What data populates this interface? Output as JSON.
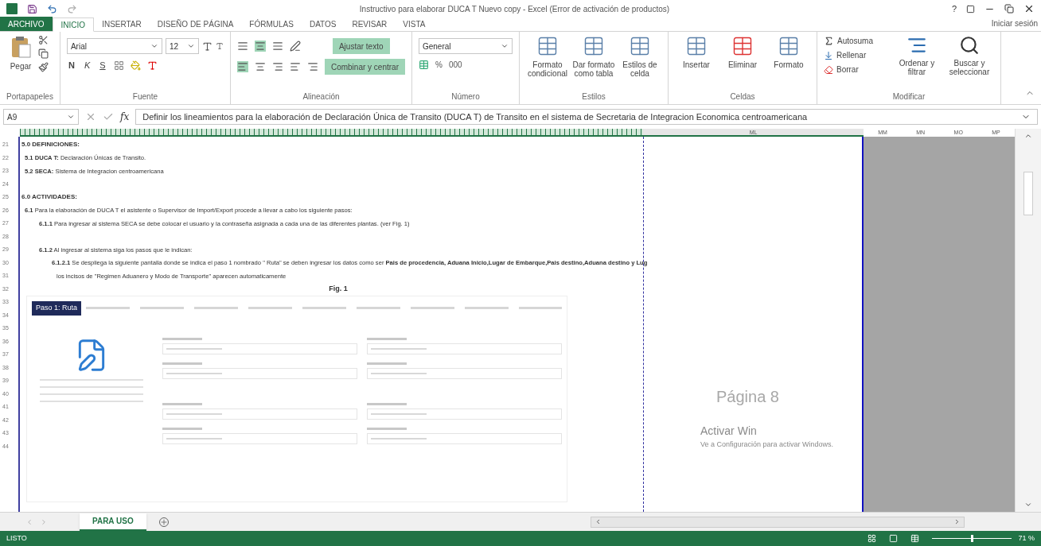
{
  "title_bar": {
    "title": "Instructivo para elaborar DUCA T  Nuevo copy - Excel (Error de activación de productos)",
    "help": "?"
  },
  "ribbon_tabs": [
    {
      "label": "ARCHIVO",
      "kind": "file",
      "selected": false
    },
    {
      "label": "INICIO",
      "kind": "tab",
      "selected": true
    },
    {
      "label": "INSERTAR",
      "kind": "tab",
      "selected": false
    },
    {
      "label": "DISEÑO DE PÁGINA",
      "kind": "tab",
      "selected": false
    },
    {
      "label": "FÓRMULAS",
      "kind": "tab",
      "selected": false
    },
    {
      "label": "DATOS",
      "kind": "tab",
      "selected": false
    },
    {
      "label": "REVISAR",
      "kind": "tab",
      "selected": false
    },
    {
      "label": "VISTA",
      "kind": "tab",
      "selected": false
    }
  ],
  "account": "Iniciar sesión",
  "ribbon_groups": [
    {
      "kind": "clipboard",
      "label": "Portapapeles",
      "paste": "Pegar"
    },
    {
      "kind": "font",
      "label": "Fuente",
      "font_name": "Arial",
      "font_size": "12",
      "styles": [
        "N",
        "K",
        "S"
      ]
    },
    {
      "kind": "alignment",
      "label": "Alineación",
      "toggles": [
        {
          "label": "Ajustar texto",
          "on": true
        },
        {
          "label": "Combinar y centrar",
          "on": true
        }
      ]
    },
    {
      "kind": "number",
      "label": "Número",
      "format": "General",
      "symbols": [
        "%",
        "000"
      ]
    },
    {
      "kind": "styles",
      "label": "Estilos",
      "buttons": [
        {
          "label": "Formato condicional"
        },
        {
          "label": "Dar formato como tabla"
        },
        {
          "label": "Estilos de celda"
        }
      ]
    },
    {
      "kind": "cells",
      "label": "Celdas",
      "buttons": [
        {
          "label": "Insertar"
        },
        {
          "label": "Eliminar"
        },
        {
          "label": "Formato"
        }
      ]
    },
    {
      "kind": "editing",
      "label": "Modificar",
      "small": [
        "Autosuma",
        "Rellenar",
        "Borrar"
      ],
      "large": [
        "Ordenar y filtrar",
        "Buscar y seleccionar"
      ]
    }
  ],
  "formula_bar": {
    "name_box": "A9",
    "function_label": "fx",
    "formula": "Definir los lineamientos para la elaboración de Declaración Única de Transito (DUCA T) de Transito en el sistema de Secretaria de Integracion Economica centroamericana"
  },
  "column_headers": {
    "page": "ML",
    "outside": [
      "MM",
      "MN",
      "MO",
      "MP"
    ]
  },
  "row_numbers": [
    "21",
    "22",
    "23",
    "24",
    "25",
    "26",
    "27",
    "28",
    "29",
    "30",
    "31",
    "32",
    "33",
    "34",
    "35",
    "36",
    "37",
    "38",
    "39",
    "40",
    "41",
    "42",
    "43",
    "44"
  ],
  "rows": [
    {
      "kind": "heading",
      "text": "5.0 DEFINICIONES:"
    },
    {
      "kind": "item",
      "text": "**5.1 DUCA T:** Declaración Únicas de Transito."
    },
    {
      "kind": "item",
      "text": "**5.2 SECA:** Sistema de Integracion centroamericana"
    },
    {
      "kind": "blank"
    },
    {
      "kind": "heading",
      "text": "6.0 ACTIVIDADES:"
    },
    {
      "kind": "item",
      "text": "**6.1** Para la elaboración de DUCA T el asistente o Supervisor de Import/Export  procede a llevar a cabo los siguiente pasos:"
    },
    {
      "kind": "subitem",
      "text": "**6.1.1** Para ingresar al sistema SECA se debe colocar el usuario y la contraseña  asignada a cada una de las diferentes plantas. (ver Fig. 1)"
    },
    {
      "kind": "blank"
    },
    {
      "kind": "subitem",
      "text": "**6.1.2** Al ingresar al sistema siga los pasos que le indican:"
    },
    {
      "kind": "subsubitem",
      "text": "**6.1.2.1**  Se despliega la siguiente pantalla donde se indica el paso 1 nombrado \" Ruta\" se deben ingresar los datos como ser **Pais de procedencia, Aduana Inicio,Lugar de Embarque,Pais destino,Aduana destino y Lug**"
    },
    {
      "kind": "continuation",
      "text": "los incisos de \"Regimen Aduanero y Modo de Transporte\" aparecen automaticamente"
    },
    {
      "kind": "caption",
      "text": "Fig. 1"
    }
  ],
  "figure": {
    "active_tab": "Paso 1: Ruta"
  },
  "page_label": "Página 8",
  "activation": [
    "Activar Win",
    "Ve a Configuración para activar Windows."
  ],
  "sheet_tabs": [
    {
      "label": "PARA USO",
      "selected": true
    }
  ],
  "status_bar": {
    "status": "LISTO",
    "zoom": "71 %",
    "level": 0.5
  }
}
